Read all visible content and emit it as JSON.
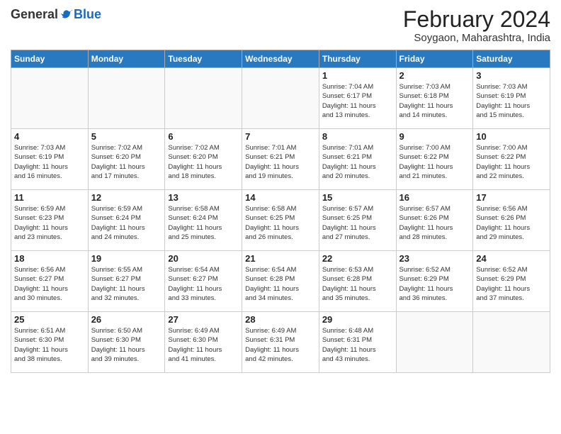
{
  "header": {
    "logo_general": "General",
    "logo_blue": "Blue",
    "month_title": "February 2024",
    "location": "Soygaon, Maharashtra, India"
  },
  "days_of_week": [
    "Sunday",
    "Monday",
    "Tuesday",
    "Wednesday",
    "Thursday",
    "Friday",
    "Saturday"
  ],
  "weeks": [
    [
      {
        "day": "",
        "info": ""
      },
      {
        "day": "",
        "info": ""
      },
      {
        "day": "",
        "info": ""
      },
      {
        "day": "",
        "info": ""
      },
      {
        "day": "1",
        "info": "Sunrise: 7:04 AM\nSunset: 6:17 PM\nDaylight: 11 hours\nand 13 minutes."
      },
      {
        "day": "2",
        "info": "Sunrise: 7:03 AM\nSunset: 6:18 PM\nDaylight: 11 hours\nand 14 minutes."
      },
      {
        "day": "3",
        "info": "Sunrise: 7:03 AM\nSunset: 6:19 PM\nDaylight: 11 hours\nand 15 minutes."
      }
    ],
    [
      {
        "day": "4",
        "info": "Sunrise: 7:03 AM\nSunset: 6:19 PM\nDaylight: 11 hours\nand 16 minutes."
      },
      {
        "day": "5",
        "info": "Sunrise: 7:02 AM\nSunset: 6:20 PM\nDaylight: 11 hours\nand 17 minutes."
      },
      {
        "day": "6",
        "info": "Sunrise: 7:02 AM\nSunset: 6:20 PM\nDaylight: 11 hours\nand 18 minutes."
      },
      {
        "day": "7",
        "info": "Sunrise: 7:01 AM\nSunset: 6:21 PM\nDaylight: 11 hours\nand 19 minutes."
      },
      {
        "day": "8",
        "info": "Sunrise: 7:01 AM\nSunset: 6:21 PM\nDaylight: 11 hours\nand 20 minutes."
      },
      {
        "day": "9",
        "info": "Sunrise: 7:00 AM\nSunset: 6:22 PM\nDaylight: 11 hours\nand 21 minutes."
      },
      {
        "day": "10",
        "info": "Sunrise: 7:00 AM\nSunset: 6:22 PM\nDaylight: 11 hours\nand 22 minutes."
      }
    ],
    [
      {
        "day": "11",
        "info": "Sunrise: 6:59 AM\nSunset: 6:23 PM\nDaylight: 11 hours\nand 23 minutes."
      },
      {
        "day": "12",
        "info": "Sunrise: 6:59 AM\nSunset: 6:24 PM\nDaylight: 11 hours\nand 24 minutes."
      },
      {
        "day": "13",
        "info": "Sunrise: 6:58 AM\nSunset: 6:24 PM\nDaylight: 11 hours\nand 25 minutes."
      },
      {
        "day": "14",
        "info": "Sunrise: 6:58 AM\nSunset: 6:25 PM\nDaylight: 11 hours\nand 26 minutes."
      },
      {
        "day": "15",
        "info": "Sunrise: 6:57 AM\nSunset: 6:25 PM\nDaylight: 11 hours\nand 27 minutes."
      },
      {
        "day": "16",
        "info": "Sunrise: 6:57 AM\nSunset: 6:26 PM\nDaylight: 11 hours\nand 28 minutes."
      },
      {
        "day": "17",
        "info": "Sunrise: 6:56 AM\nSunset: 6:26 PM\nDaylight: 11 hours\nand 29 minutes."
      }
    ],
    [
      {
        "day": "18",
        "info": "Sunrise: 6:56 AM\nSunset: 6:27 PM\nDaylight: 11 hours\nand 30 minutes."
      },
      {
        "day": "19",
        "info": "Sunrise: 6:55 AM\nSunset: 6:27 PM\nDaylight: 11 hours\nand 32 minutes."
      },
      {
        "day": "20",
        "info": "Sunrise: 6:54 AM\nSunset: 6:27 PM\nDaylight: 11 hours\nand 33 minutes."
      },
      {
        "day": "21",
        "info": "Sunrise: 6:54 AM\nSunset: 6:28 PM\nDaylight: 11 hours\nand 34 minutes."
      },
      {
        "day": "22",
        "info": "Sunrise: 6:53 AM\nSunset: 6:28 PM\nDaylight: 11 hours\nand 35 minutes."
      },
      {
        "day": "23",
        "info": "Sunrise: 6:52 AM\nSunset: 6:29 PM\nDaylight: 11 hours\nand 36 minutes."
      },
      {
        "day": "24",
        "info": "Sunrise: 6:52 AM\nSunset: 6:29 PM\nDaylight: 11 hours\nand 37 minutes."
      }
    ],
    [
      {
        "day": "25",
        "info": "Sunrise: 6:51 AM\nSunset: 6:30 PM\nDaylight: 11 hours\nand 38 minutes."
      },
      {
        "day": "26",
        "info": "Sunrise: 6:50 AM\nSunset: 6:30 PM\nDaylight: 11 hours\nand 39 minutes."
      },
      {
        "day": "27",
        "info": "Sunrise: 6:49 AM\nSunset: 6:30 PM\nDaylight: 11 hours\nand 41 minutes."
      },
      {
        "day": "28",
        "info": "Sunrise: 6:49 AM\nSunset: 6:31 PM\nDaylight: 11 hours\nand 42 minutes."
      },
      {
        "day": "29",
        "info": "Sunrise: 6:48 AM\nSunset: 6:31 PM\nDaylight: 11 hours\nand 43 minutes."
      },
      {
        "day": "",
        "info": ""
      },
      {
        "day": "",
        "info": ""
      }
    ]
  ]
}
